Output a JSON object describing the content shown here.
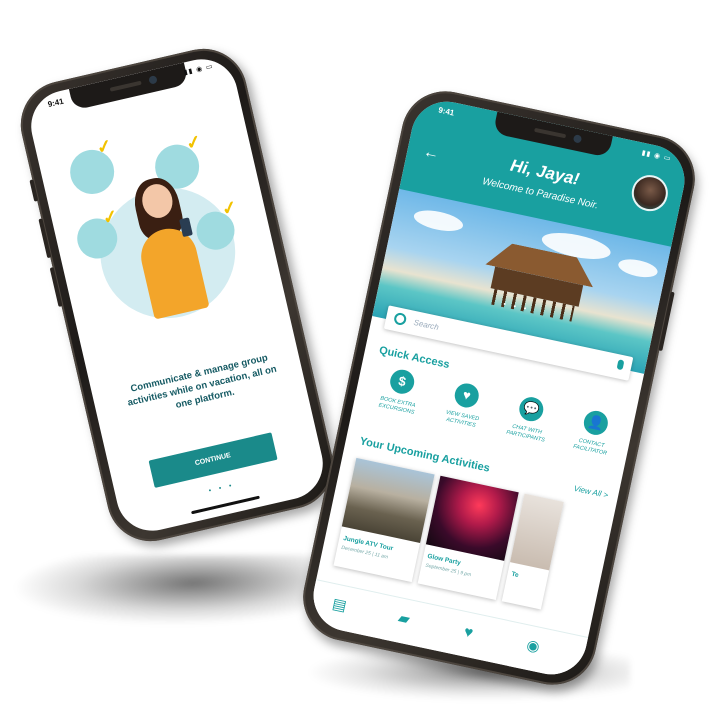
{
  "left_phone": {
    "status_time": "9:41",
    "status_icons": "▮▮ ◉ ▭",
    "tagline": "Communicate & manage group activities while on vacation, all on one platform.",
    "continue_label": "CONTINUE",
    "page_dots": "• • •"
  },
  "right_phone": {
    "status_time": "9:41",
    "status_icons": "▮▮ ◉ ▭",
    "greeting": "Hi, Jaya!",
    "welcome": "Welcome to Paradise Noir.",
    "hero_dots": "• • •",
    "search_placeholder": "Search",
    "quick_access": {
      "title": "Quick Access",
      "items": [
        {
          "icon": "$",
          "label": "BOOK EXTRA EXCURSIONS"
        },
        {
          "icon": "♥",
          "label": "VIEW SAVED ACTIVITIES"
        },
        {
          "icon": "💬",
          "label": "CHAT WITH PARTICIPANTS"
        },
        {
          "icon": "👤",
          "label": "CONTACT FACILITATOR"
        }
      ]
    },
    "upcoming": {
      "title": "Your Upcoming Activities",
      "view_all": "View All >",
      "cards": [
        {
          "title": "Jungle ATV Tour",
          "date": "December 25 | 11 am"
        },
        {
          "title": "Glow Party",
          "date": "September 25 | 9 pm"
        },
        {
          "title": "Te",
          "date": ""
        }
      ]
    },
    "nav_icons": [
      "dashboard-icon",
      "chat-icon",
      "heart-icon",
      "profile-icon"
    ]
  }
}
